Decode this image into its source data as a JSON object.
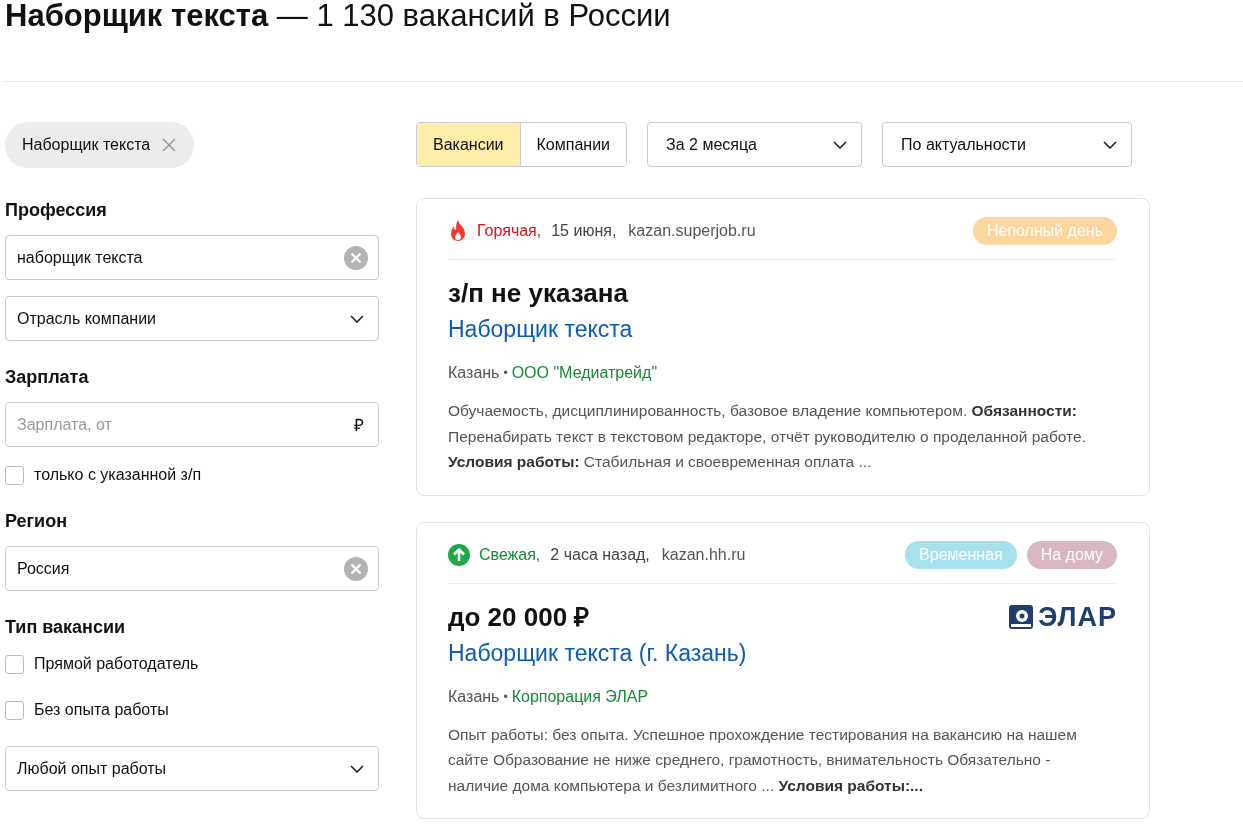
{
  "title": {
    "main": "Наборщик текста",
    "rest": "— 1 130 вакансий в России"
  },
  "chip": {
    "label": "Наборщик текста"
  },
  "filters": [
    {
      "kind": "heading",
      "text": "Профессия"
    },
    {
      "kind": "input",
      "value": "наборщик текста"
    },
    {
      "kind": "select",
      "value": "Отрасль компании"
    },
    {
      "kind": "heading",
      "text": "Зарплата"
    },
    {
      "kind": "money",
      "placeholder": "Зарплата, от",
      "suffix": "₽"
    },
    {
      "kind": "checkbox",
      "label": "только с указанной з/п",
      "checked": false
    },
    {
      "kind": "heading",
      "text": "Регион"
    },
    {
      "kind": "input",
      "value": "Россия"
    },
    {
      "kind": "heading",
      "text": "Тип вакансии"
    },
    {
      "kind": "checkbox",
      "label": "Прямой работодатель",
      "checked": false
    },
    {
      "kind": "checkbox",
      "label": "Без опыта работы",
      "checked": false
    },
    {
      "kind": "select",
      "value": "Любой опыт работы"
    }
  ],
  "tabs": [
    {
      "label": "Вакансии",
      "selected": true
    },
    {
      "label": "Компании",
      "selected": false
    }
  ],
  "dropdowns": [
    "За 2 месяца",
    "По актуальности"
  ],
  "vacancies": [
    {
      "status": {
        "kind": "hot",
        "label": "Горячая,"
      },
      "date": "15 июня,",
      "source": "kazan.superjob.ru",
      "tags": [
        {
          "label": "Неполный день",
          "color": "#fdd59f"
        }
      ],
      "salary": "з/п не указана",
      "title": "Наборщик текста",
      "city": "Казань",
      "sep": "•",
      "company": "ООО \"Медиатрейд\"",
      "description": "Обучаемость, дисциплинированность, базовое владение компьютером. **Обязанности:** Перенабирать текст в текстовом редакторе, отчёт руководителю о проделанной работе. **Условия работы:** Стабильная и своевременная оплата ..."
    },
    {
      "status": {
        "kind": "fresh",
        "label": "Свежая,"
      },
      "date": "2 часа назад,",
      "source": "kazan.hh.ru",
      "tags": [
        {
          "label": "Временная",
          "color": "#a8e1ee"
        },
        {
          "label": "На дому",
          "color": "#d9b8c3"
        }
      ],
      "salary": "до 20 000 ₽",
      "title": "Наборщик текста (г. Казань)",
      "city": "Казань",
      "sep": "•",
      "company": "Корпорация ЭЛАР",
      "logo": "ЭЛАР",
      "description": "Опыт работы: без опыта. Успешное прохождение тестирования на вакансию на нашем сайте Образование не ниже среднего, грамотность, внимательность Обязательно - наличие дома компьютера и безлимитного ... **Условия работы:...**"
    }
  ]
}
